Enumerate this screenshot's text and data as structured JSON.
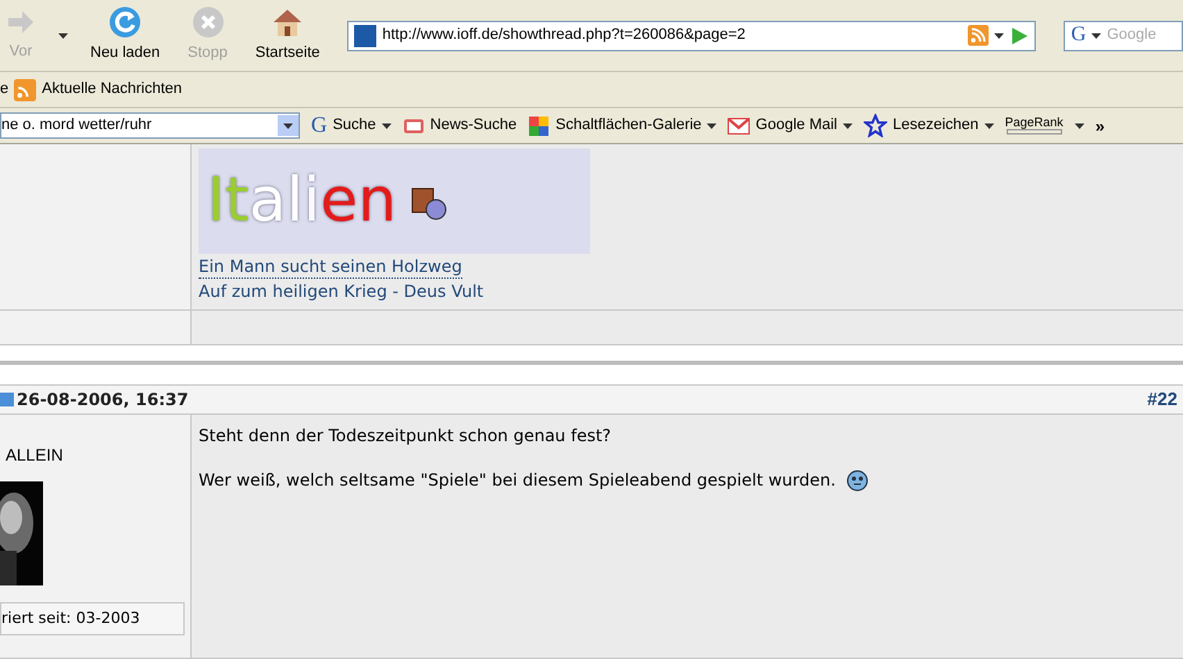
{
  "nav_toolbar": {
    "buttons": [
      {
        "label": "Vor",
        "disabled": true,
        "kind": "forward"
      },
      {
        "label": "Neu laden",
        "disabled": false,
        "kind": "reload"
      },
      {
        "label": "Stopp",
        "disabled": true,
        "kind": "stop"
      },
      {
        "label": "Startseite",
        "disabled": false,
        "kind": "home"
      }
    ],
    "url": "http://www.ioff.de/showthread.php?t=260086&page=2",
    "search_placeholder": "Google",
    "search_engine_letter": "G"
  },
  "bookmarks_bar": {
    "items": [
      "e",
      "Aktuelle Nachrichten"
    ]
  },
  "google_toolbar": {
    "search_value": "ne o. mord wetter/ruhr",
    "items": [
      {
        "label": "Suche",
        "kind": "google",
        "letter": "G"
      },
      {
        "label": "News-Suche",
        "kind": "news"
      },
      {
        "label": "Schaltflächen-Galerie",
        "kind": "gallery"
      },
      {
        "label": "Google Mail",
        "kind": "mail"
      },
      {
        "label": "Lesezeichen",
        "kind": "star"
      }
    ],
    "pagerank": "PageRank",
    "more": "»"
  },
  "signature": {
    "logo": [
      {
        "text": "It",
        "color": "#9acd32"
      },
      {
        "text": "al",
        "color": "#ffffff"
      },
      {
        "text": "i",
        "color": "#fafaff"
      },
      {
        "text": "en",
        "color": "#e31b1b"
      }
    ],
    "links": [
      "Ein Mann sucht seinen Holzweg",
      "Auf zum heiligen Krieg - Deus Vult"
    ]
  },
  "post": {
    "date": "26-08-2006, 16:37",
    "number": "#22",
    "user_title": "ALLEIN",
    "registered": "riert seit: 03-2003",
    "paragraphs": [
      "Steht denn der Todeszeitpunkt schon genau fest?",
      "Wer weiß, welch seltsame \"Spiele\" bei diesem Spieleabend gespielt wurden."
    ]
  }
}
